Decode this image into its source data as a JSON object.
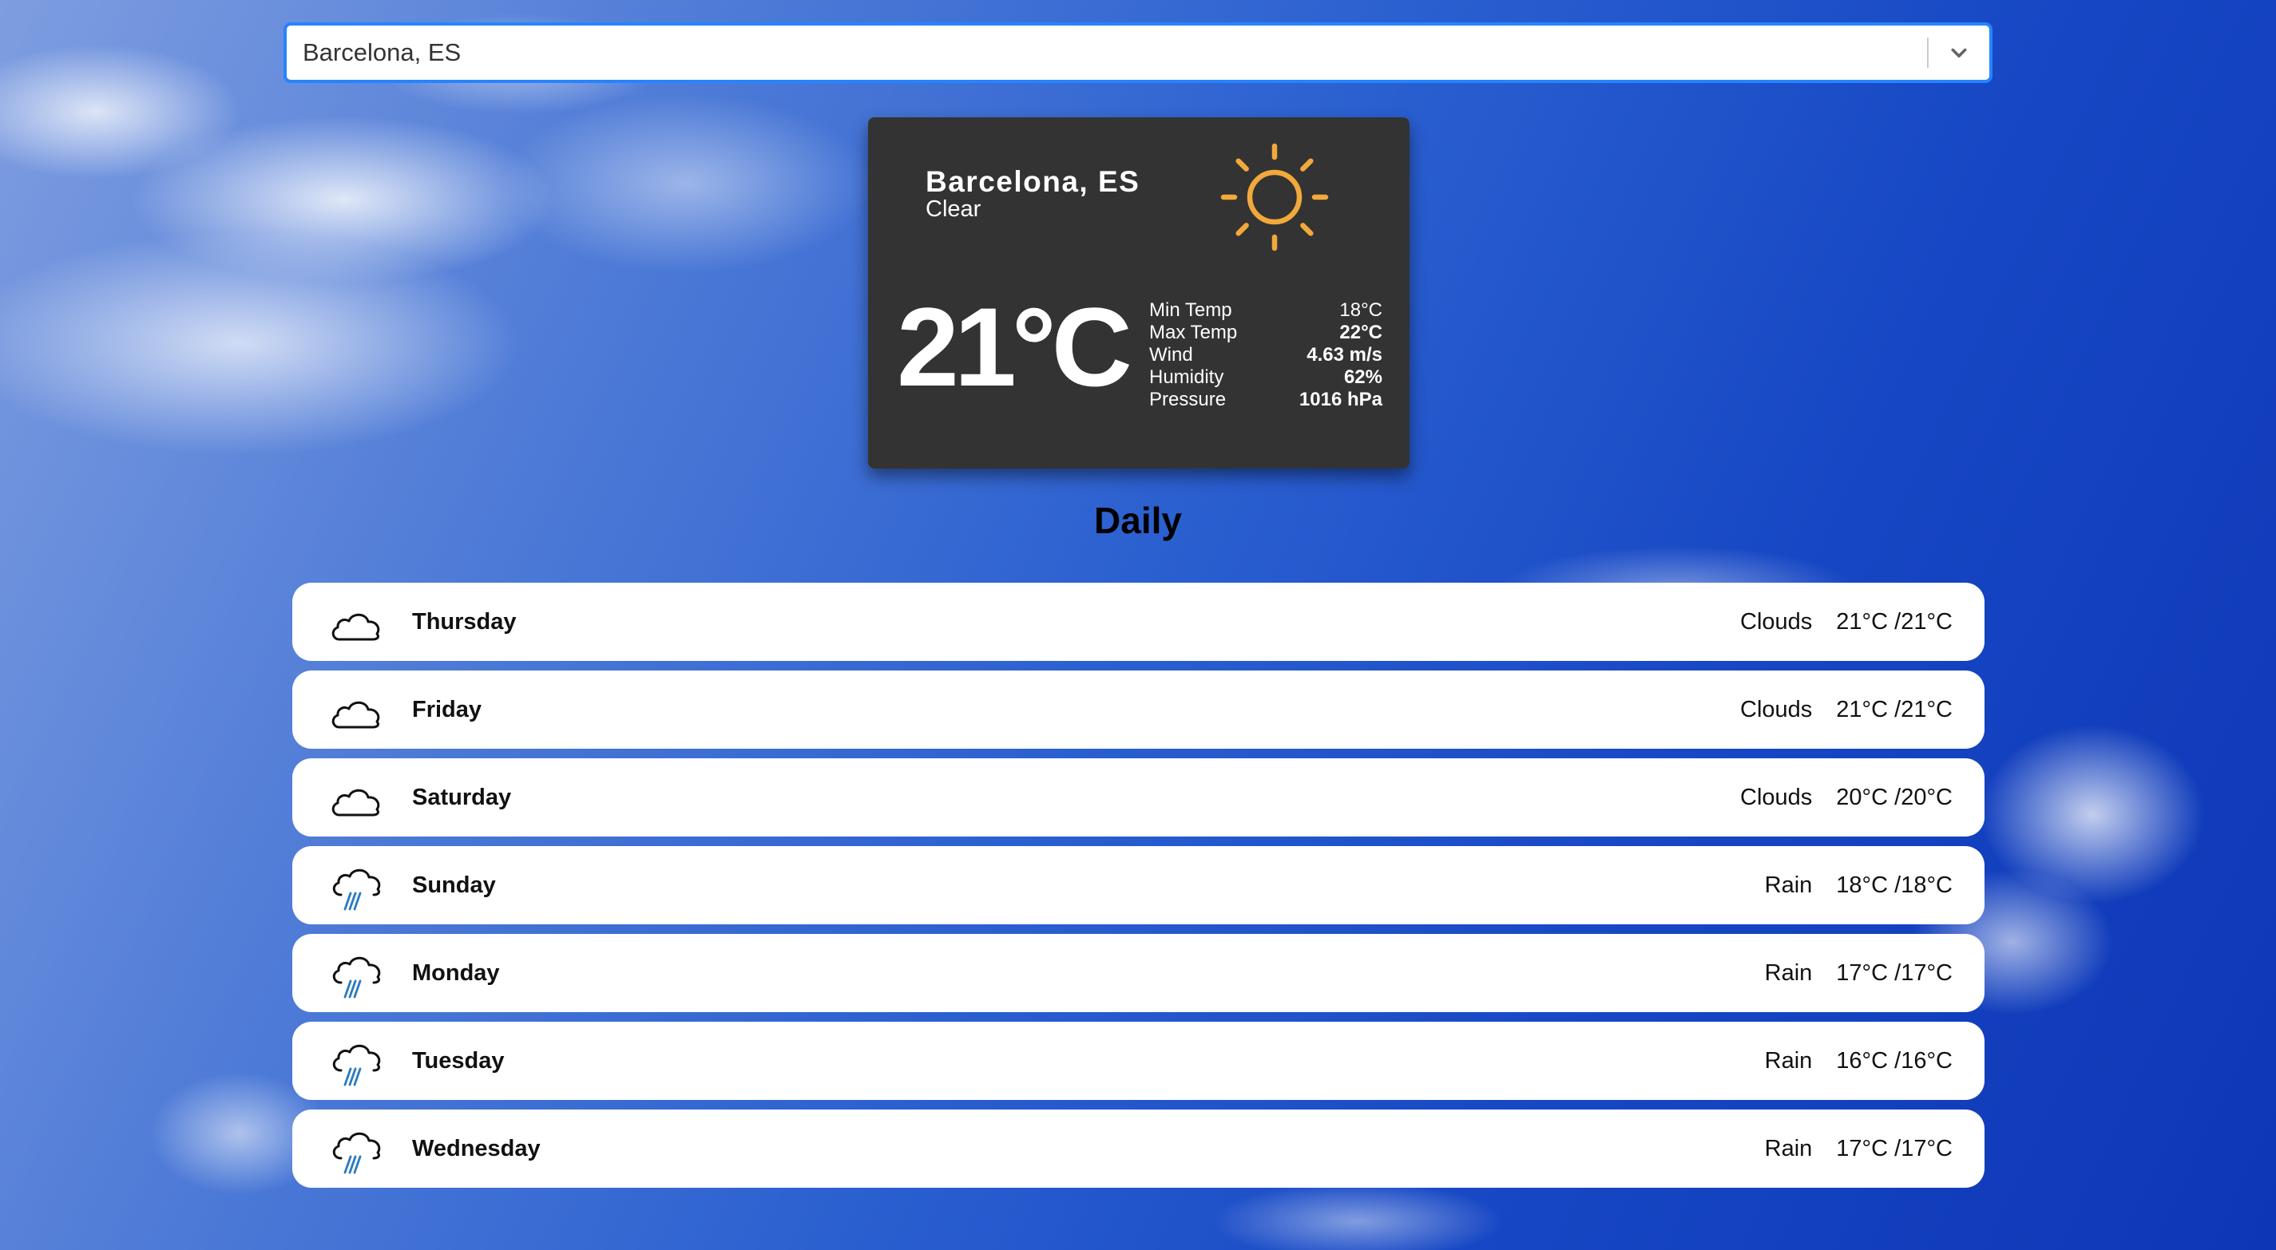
{
  "search": {
    "value": "Barcelona, ES"
  },
  "current": {
    "city": "Barcelona, ES",
    "description": "Clear",
    "icon": "sun-icon",
    "temperature": "21°C",
    "details": [
      {
        "label": "Min Temp",
        "value": "18°C"
      },
      {
        "label": "Max Temp",
        "value": "22°C"
      },
      {
        "label": "Wind",
        "value": "4.63 m/s"
      },
      {
        "label": "Humidity",
        "value": "62%"
      },
      {
        "label": "Pressure",
        "value": "1016 hPa"
      }
    ]
  },
  "daily": {
    "title": "Daily",
    "days": [
      {
        "day": "Thursday",
        "icon": "cloud-icon",
        "condition": "Clouds",
        "temps": "21°C /21°C"
      },
      {
        "day": "Friday",
        "icon": "cloud-icon",
        "condition": "Clouds",
        "temps": "21°C /21°C"
      },
      {
        "day": "Saturday",
        "icon": "cloud-icon",
        "condition": "Clouds",
        "temps": "20°C /20°C"
      },
      {
        "day": "Sunday",
        "icon": "rain-icon",
        "condition": "Rain",
        "temps": "18°C /18°C"
      },
      {
        "day": "Monday",
        "icon": "rain-icon",
        "condition": "Rain",
        "temps": "17°C /17°C"
      },
      {
        "day": "Tuesday",
        "icon": "rain-icon",
        "condition": "Rain",
        "temps": "16°C /16°C"
      },
      {
        "day": "Wednesday",
        "icon": "rain-icon",
        "condition": "Rain",
        "temps": "17°C /17°C"
      }
    ]
  },
  "colors": {
    "sun": "#f2a93b",
    "rain": "#2b7bc0",
    "card": "#333333",
    "focus": "#2684ff"
  }
}
